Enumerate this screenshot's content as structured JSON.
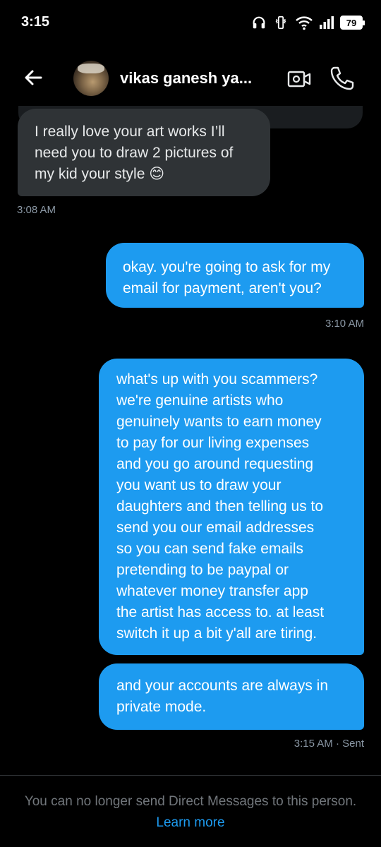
{
  "status_bar": {
    "time": "3:15",
    "battery": "79",
    "icons": [
      "headphones-icon",
      "bluetooth-vibrate-icon",
      "wifi-icon",
      "signal-icon",
      "battery-icon"
    ]
  },
  "header": {
    "contact_name": "vikas ganesh ya...",
    "icons": [
      "back-arrow-icon",
      "avatar",
      "video-call-icon",
      "phone-icon"
    ]
  },
  "messages": [
    {
      "direction": "received",
      "text": "I really love your art works I’ll\nneed you to draw 2 pictures of\nmy kid your style 😊",
      "timestamp": "3:08 AM"
    },
    {
      "direction": "sent",
      "text": "okay. you're going to ask for my\nemail for payment, aren't you?",
      "timestamp": "3:10 AM"
    },
    {
      "direction": "sent",
      "text": "what's up with you scammers?\nwe're genuine artists who\ngenuinely wants to earn money\nto pay for our living expenses\nand you go around requesting\nyou want us to draw your\ndaughters and then telling us to\nsend you our email addresses\nso you can send fake emails\npretending to be paypal or\nwhatever money transfer app\nthe artist has access to. at least\nswitch it up a bit y'all are tiring."
    },
    {
      "direction": "sent",
      "text": "and your accounts are always in\nprivate mode.",
      "timestamp": "3:15 AM · Sent"
    }
  ],
  "footer": {
    "notice": "You can no longer send Direct Messages to this person.",
    "link": "Learn more"
  },
  "colors": {
    "background": "#000000",
    "sent_bubble": "#1d9bf0",
    "received_bubble": "#2f3336",
    "muted_text": "#71767b",
    "link": "#1d9bf0"
  }
}
